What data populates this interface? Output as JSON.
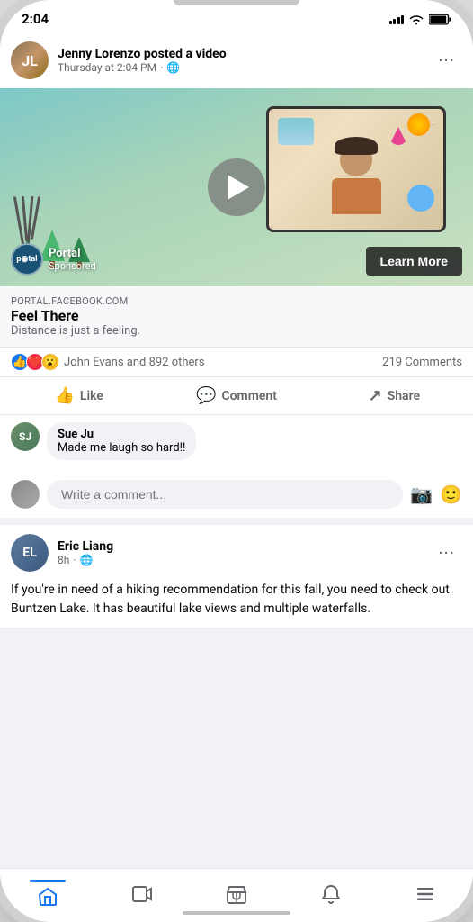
{
  "phone": {
    "time": "2:04"
  },
  "post1": {
    "author": "Jenny Lorenzo posted a video",
    "subtitle": "Thursday at 2:04 PM",
    "ad": {
      "url": "PORTAL.FACEBOOK.COM",
      "title": "Feel There",
      "body": "Distance is just a feeling.",
      "logo_text": "portal",
      "brand": "Portal",
      "sponsored": "Sponsored",
      "learn_more": "Learn More",
      "more_icon": "···"
    },
    "reactions": {
      "text": "John Evans and 892 others",
      "comments": "219 Comments"
    },
    "actions": {
      "like": "Like",
      "comment": "Comment",
      "share": "Share"
    },
    "comment": {
      "author": "Sue Ju",
      "text": "Made me laugh so hard!!"
    },
    "comment_placeholder": "Write a comment..."
  },
  "post2": {
    "author": "Eric Liang",
    "subtitle": "8h",
    "text": "If you're in need of a hiking recommendation for this fall, you need to check out Buntzen Lake. It has beautiful lake views and multiple waterfalls."
  },
  "nav": {
    "home": "home",
    "video": "video",
    "marketplace": "marketplace",
    "notifications": "notifications",
    "menu": "menu"
  }
}
